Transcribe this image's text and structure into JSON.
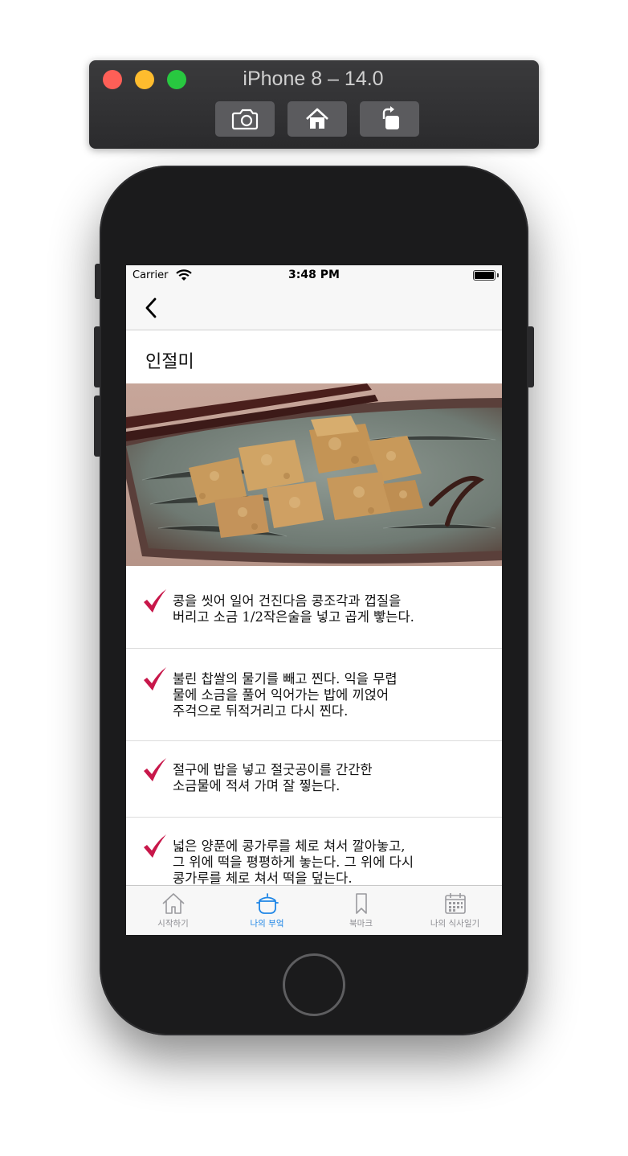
{
  "simulator": {
    "title": "iPhone 8 – 14.0"
  },
  "status_bar": {
    "carrier": "Carrier",
    "time": "3:48 PM"
  },
  "recipe": {
    "title": "인절미",
    "steps": [
      "콩을 씻어 일어 건진다음 콩조각과 껍질을\n버리고 소금 1/2작은술을 넣고 곱게 빻는다.",
      "불린 찹쌀의 물기를 빼고 찐다. 익을 무렵\n물에 소금을 풀어 익어가는 밥에 끼얹어\n주걱으로 뒤적거리고 다시 찐다.",
      "절구에 밥을 넣고 절굿공이를 간간한\n소금물에 적셔 가며 잘 찧는다.",
      "넓은 양푼에 콩가루를 체로 쳐서 깔아놓고,\n그 위에 떡을 평평하게 놓는다. 그 위에 다시\n콩가루를 체로 쳐서 떡을 덮는다."
    ]
  },
  "tabs": [
    {
      "label": "시작하기",
      "icon": "house-icon",
      "active": false
    },
    {
      "label": "나의 부엌",
      "icon": "pot-icon",
      "active": true
    },
    {
      "label": "북마크",
      "icon": "bookmark-icon",
      "active": false
    },
    {
      "label": "나의 식사일기",
      "icon": "calendar-icon",
      "active": false
    }
  ],
  "colors": {
    "accent": "#1f86e6",
    "check": "#c8174a",
    "inactive_tab": "#8e8e93"
  }
}
